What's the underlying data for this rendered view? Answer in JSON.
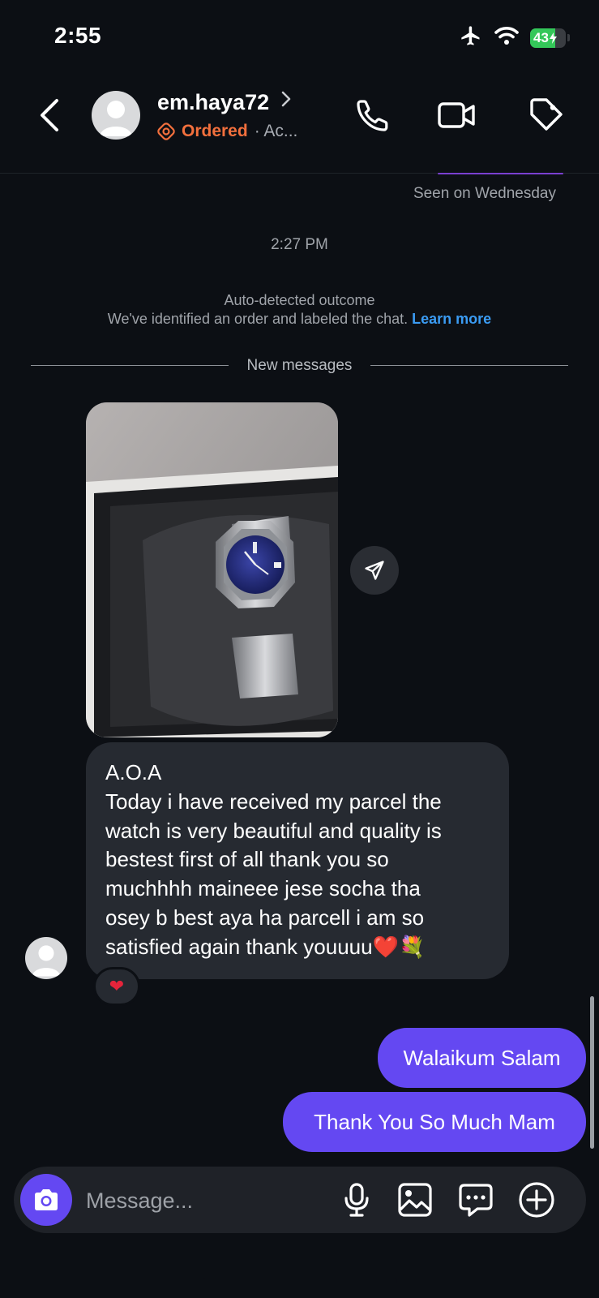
{
  "status_bar": {
    "time": "2:55",
    "battery": "43",
    "icons": [
      "airplane-icon",
      "wifi-icon",
      "battery-charging-icon"
    ]
  },
  "header": {
    "username": "em.haya72",
    "label": "Ordered",
    "sub_rest": "· Ac...",
    "actions": [
      "phone-icon",
      "video-icon",
      "tag-icon"
    ]
  },
  "conversation": {
    "seen": "Seen on Wednesday",
    "timestamp": "2:27 PM",
    "auto_title": "Auto-detected outcome",
    "auto_desc": "We've identified an order and labeled the chat.",
    "learn_more": "Learn more",
    "new_messages": "New messages",
    "received": {
      "lines": [
        "A.O.A",
        "Today i have received my parcel the",
        "watch is very beautiful and quality is",
        "bestest first of all thank you so",
        "muchhhh maineee jese socha tha",
        "osey b best aya ha parcell i am so",
        "satisfied again thank youuuu❤️💐"
      ],
      "reaction": "❤"
    },
    "sent": [
      "Walaikum Salam",
      "Thank You So Much Mam"
    ]
  },
  "composer": {
    "placeholder": "Message...",
    "icons": [
      "camera-icon",
      "microphone-icon",
      "gallery-icon",
      "sticker-icon",
      "add-icon"
    ]
  },
  "colors": {
    "background": "#0c0f14",
    "accent": "#6448f2",
    "ordered": "#f3703d",
    "link": "#3b9cf4",
    "bubble_in": "#262a31"
  }
}
